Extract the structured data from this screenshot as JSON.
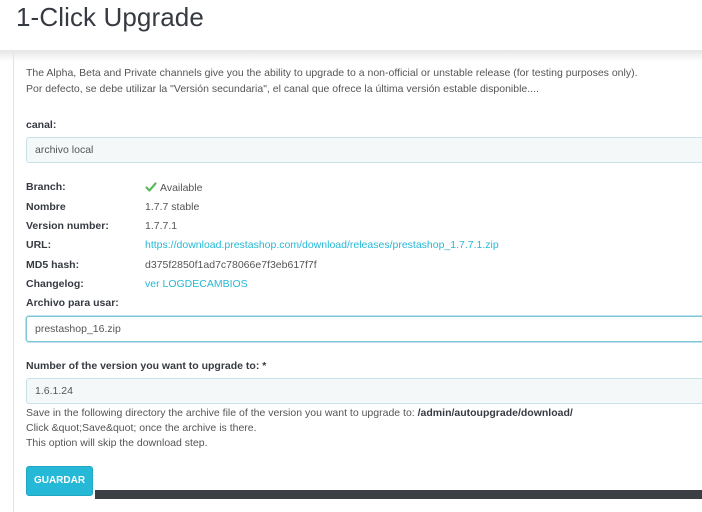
{
  "header": {
    "title": "1-Click Upgrade"
  },
  "description": {
    "line1": "The Alpha, Beta and Private channels give you the ability to upgrade to a non-official or unstable release (for testing purposes only).",
    "line2": "Por defecto, se debe utilizar la \"Versión secundaria\", el canal que ofrece la última versión estable disponible...."
  },
  "channel": {
    "label": "canal:",
    "value": "archivo local"
  },
  "info_rows": [
    {
      "label": "Branch:",
      "value": "Available",
      "icon": "check-icon",
      "icon_color": "#5cb85c"
    },
    {
      "label": "Nombre",
      "value": "1.7.7 stable"
    },
    {
      "label": "Version number:",
      "value": "1.7.7.1"
    },
    {
      "label": "URL:",
      "value": "https://download.prestashop.com/download/releases/prestashop_1.7.7.1.zip",
      "link": true
    },
    {
      "label": "MD5 hash:",
      "value": "d375f2850f1ad7c78066e7f3eb617f7f"
    },
    {
      "label": "Changelog:",
      "value": "ver LOGDECAMBIOS",
      "link": true
    }
  ],
  "archive": {
    "label": "Archivo para usar:",
    "value": "prestashop_16.zip"
  },
  "version": {
    "label": "Number of the version you want to upgrade to: *",
    "value": "1.6.1.24"
  },
  "help": {
    "line1_prefix": "Save in the following directory the archive file of the version you want to upgrade to: ",
    "line1_path": "/admin/autoupgrade/download/",
    "line2": "Click &quot;Save&quot; once the archive is there.",
    "line3": "This option will skip the download step."
  },
  "save_button": {
    "label": "GUARDAR"
  },
  "colors": {
    "accent": "#25b9d7",
    "available": "#5cb85c"
  }
}
